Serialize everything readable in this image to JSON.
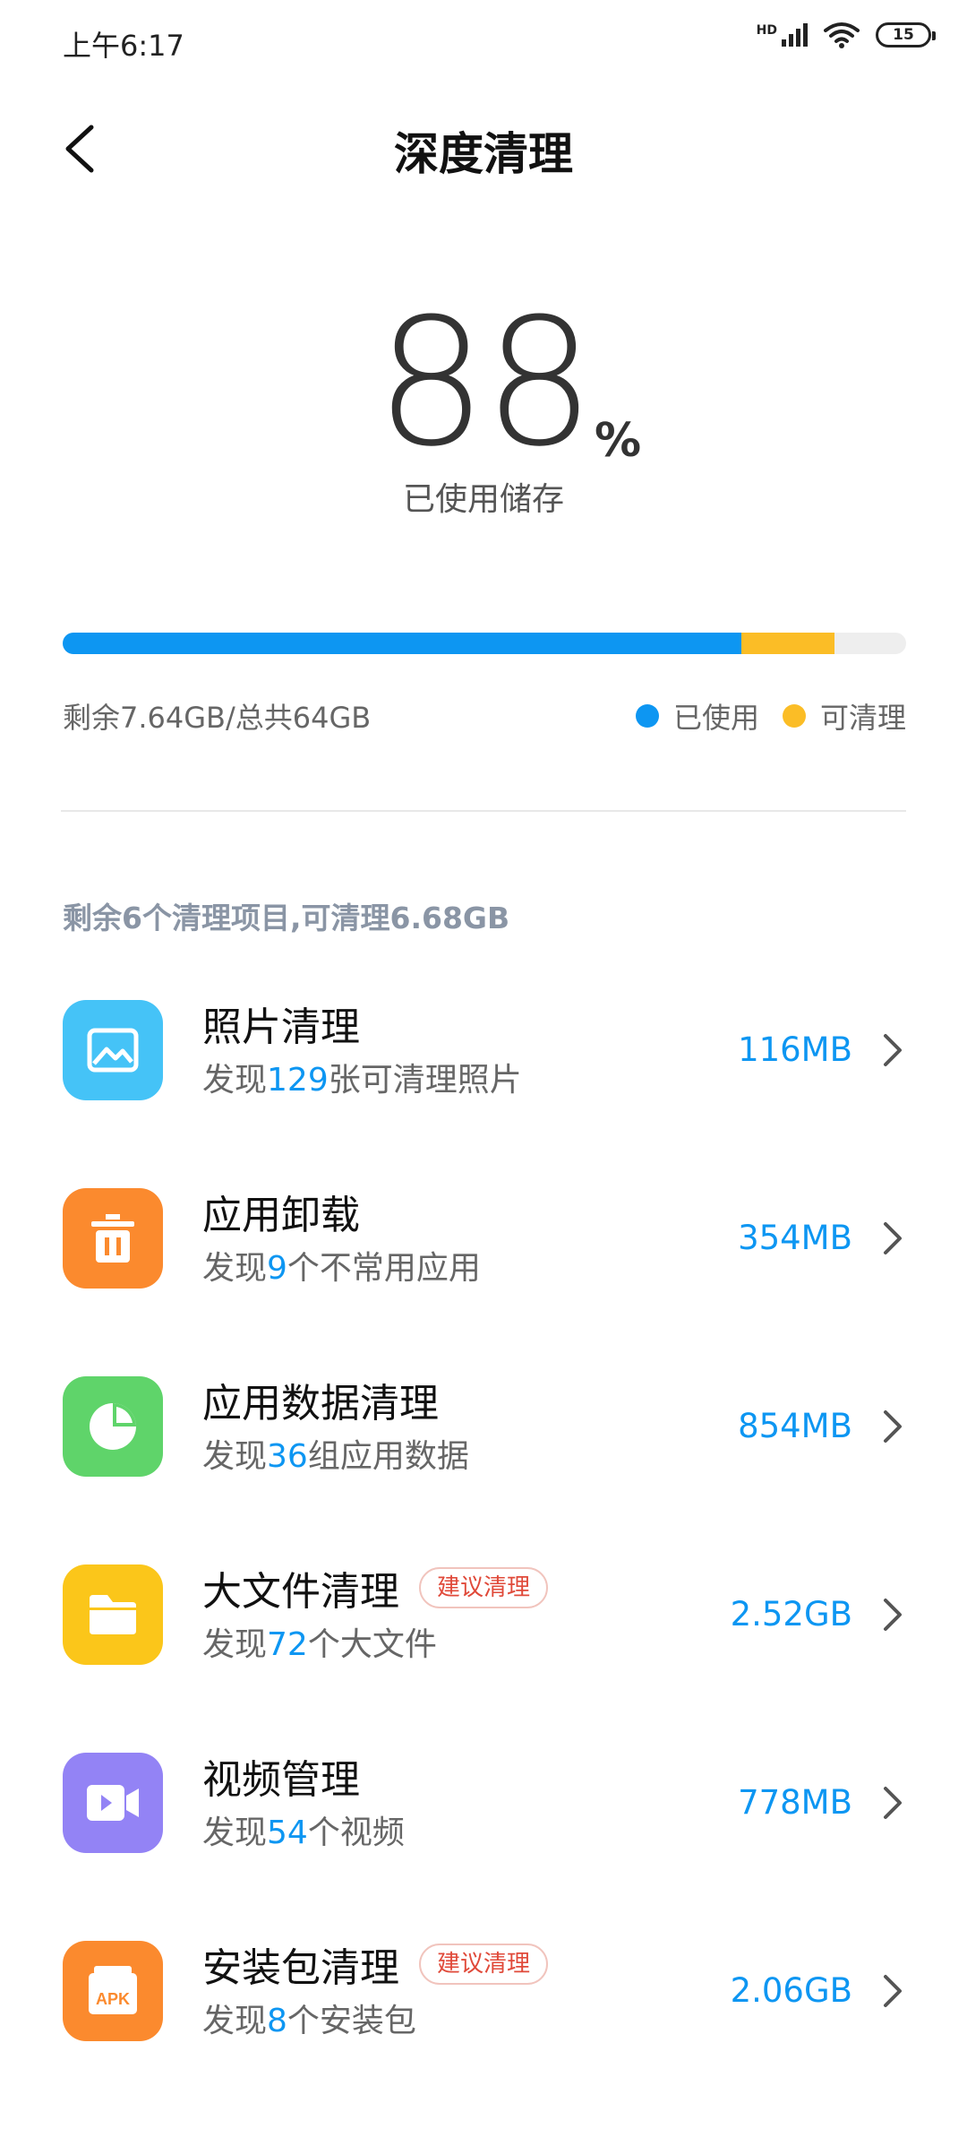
{
  "status_bar": {
    "time": "上午6:17",
    "network": "HD",
    "battery": "15"
  },
  "header": {
    "title": "深度清理"
  },
  "usage": {
    "percent": "88",
    "percent_sign": "%",
    "label": "已使用储存",
    "used_fraction": 0.805,
    "cleanable_fraction": 0.11,
    "remaining_text": "剩余7.64GB/总共64GB",
    "legend_used": "已使用",
    "legend_cleanable": "可清理",
    "color_used": "#0d96f2",
    "color_cleanable": "#fbbd26"
  },
  "summary": "剩余6个清理项目,可清理6.68GB",
  "items": [
    {
      "title": "照片清理",
      "badge": "",
      "desc_prefix": "发现",
      "count": "129",
      "desc_suffix": "张可清理照片",
      "size": "116MB",
      "icon": "photo-icon",
      "color": "#45c3f7"
    },
    {
      "title": "应用卸载",
      "badge": "",
      "desc_prefix": "发现",
      "count": "9",
      "desc_suffix": "个不常用应用",
      "size": "354MB",
      "icon": "trash-icon",
      "color": "#fb8a2e"
    },
    {
      "title": "应用数据清理",
      "badge": "",
      "desc_prefix": "发现",
      "count": "36",
      "desc_suffix": "组应用数据",
      "size": "854MB",
      "icon": "pie-chart-icon",
      "color": "#5fd46a"
    },
    {
      "title": "大文件清理",
      "badge": "建议清理",
      "desc_prefix": "发现",
      "count": "72",
      "desc_suffix": "个大文件",
      "size": "2.52GB",
      "icon": "folder-icon",
      "color": "#fbc61a"
    },
    {
      "title": "视频管理",
      "badge": "",
      "desc_prefix": "发现",
      "count": "54",
      "desc_suffix": "个视频",
      "size": "778MB",
      "icon": "video-icon",
      "color": "#9383f5"
    },
    {
      "title": "安装包清理",
      "badge": "建议清理",
      "desc_prefix": "发现",
      "count": "8",
      "desc_suffix": "个安装包",
      "size": "2.06GB",
      "icon": "apk-icon",
      "color": "#fb8a2e",
      "icon_text": "APK"
    }
  ]
}
